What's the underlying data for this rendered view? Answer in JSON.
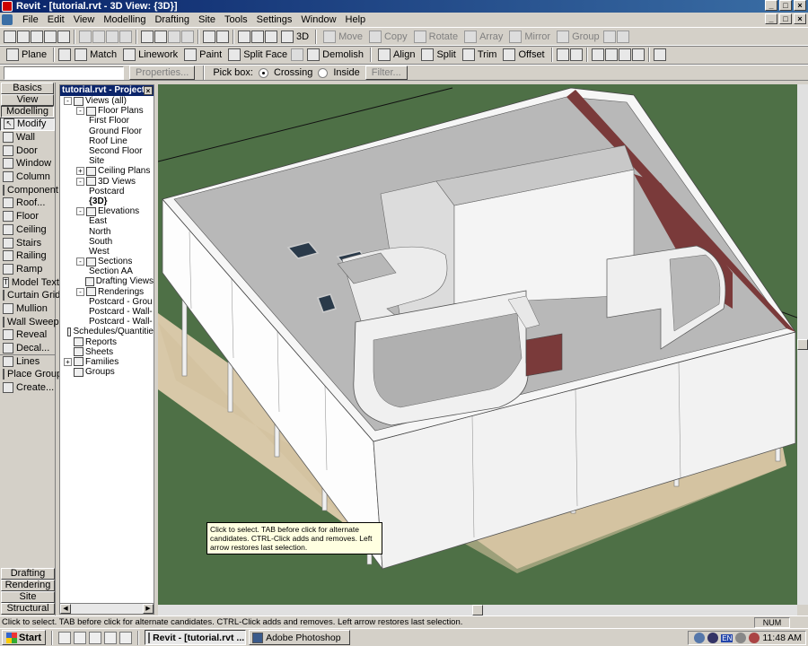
{
  "window": {
    "title": "Revit - [tutorial.rvt - 3D View: {3D}]",
    "controls": [
      "_",
      "□",
      "×"
    ]
  },
  "menubar": {
    "items": [
      "File",
      "Edit",
      "View",
      "Modelling",
      "Drafting",
      "Site",
      "Tools",
      "Settings",
      "Window",
      "Help"
    ]
  },
  "toolbar1": {
    "view_3d": "3D",
    "move": "Move",
    "copy": "Copy",
    "rotate": "Rotate",
    "array": "Array",
    "mirror": "Mirror",
    "group": "Group"
  },
  "toolbar2": {
    "plane": "Plane",
    "match": "Match",
    "linework": "Linework",
    "paint": "Paint",
    "split_face": "Split Face",
    "demolish": "Demolish",
    "align": "Align",
    "split": "Split",
    "trim": "Trim",
    "offset": "Offset"
  },
  "options_bar": {
    "properties": "Properties...",
    "pick_box": "Pick box:",
    "crossing": "Crossing",
    "inside": "Inside",
    "filter": "Filter..."
  },
  "design_bar": {
    "top_tabs": [
      "Basics",
      "View",
      "Modelling"
    ],
    "tools": [
      "Modify",
      "Wall",
      "Door",
      "Window",
      "Column",
      "Component",
      "Roof...",
      "Floor",
      "Ceiling",
      "Stairs",
      "Railing",
      "Ramp",
      "Model Text",
      "Curtain Grid",
      "Mullion",
      "Wall Sweep",
      "Reveal",
      "Decal...",
      "Lines",
      "Place Group",
      "Create..."
    ],
    "bottom_tabs": [
      "Drafting",
      "Rendering",
      "Site",
      "Structural"
    ]
  },
  "project_browser": {
    "title": "tutorial.rvt - Project...",
    "nodes": [
      {
        "label": "Views (all)",
        "level": 0,
        "toggle": "-"
      },
      {
        "label": "Floor Plans",
        "level": 1,
        "toggle": "-"
      },
      {
        "label": "First Floor",
        "level": 2
      },
      {
        "label": "Ground Floor",
        "level": 2
      },
      {
        "label": "Roof Line",
        "level": 2
      },
      {
        "label": "Second Floor",
        "level": 2
      },
      {
        "label": "Site",
        "level": 2
      },
      {
        "label": "Ceiling Plans",
        "level": 1,
        "toggle": "+"
      },
      {
        "label": "3D Views",
        "level": 1,
        "toggle": "-"
      },
      {
        "label": "Postcard",
        "level": 2
      },
      {
        "label": "{3D}",
        "level": 2,
        "bold": true
      },
      {
        "label": "Elevations",
        "level": 1,
        "toggle": "-"
      },
      {
        "label": "East",
        "level": 2
      },
      {
        "label": "North",
        "level": 2
      },
      {
        "label": "South",
        "level": 2
      },
      {
        "label": "West",
        "level": 2
      },
      {
        "label": "Sections",
        "level": 1,
        "toggle": "-"
      },
      {
        "label": "Section AA",
        "level": 2
      },
      {
        "label": "Drafting Views",
        "level": 1
      },
      {
        "label": "Renderings",
        "level": 1,
        "toggle": "-"
      },
      {
        "label": "Postcard - Grou",
        "level": 2
      },
      {
        "label": "Postcard - Wall-",
        "level": 2
      },
      {
        "label": "Postcard - Wall-",
        "level": 2
      },
      {
        "label": "Schedules/Quantitie",
        "level": 0
      },
      {
        "label": "Reports",
        "level": 0
      },
      {
        "label": "Sheets",
        "level": 0
      },
      {
        "label": "Families",
        "level": 0,
        "toggle": "+"
      },
      {
        "label": "Groups",
        "level": 0
      }
    ]
  },
  "tooltip": {
    "text": "Click to select. TAB before click for alternate candidates. CTRL-Click adds and removes. Left arrow restores last selection."
  },
  "statusbar": {
    "text": "Click to select. TAB before click for alternate candidates. CTRL-Click adds and removes. Left arrow restores last selection.",
    "num": "NUM"
  },
  "taskbar": {
    "start": "Start",
    "tasks": [
      "Revit - [tutorial.rvt ...",
      "Adobe Photoshop"
    ],
    "lang": "EN",
    "clock": "11:48 AM"
  },
  "colors": {
    "viewport_bg": "#4e7046",
    "roof": "#b8b8b8",
    "wall": "#f4f4f4",
    "parapet_inner": "#7a3a3a",
    "ground": "#d8c8a8"
  }
}
